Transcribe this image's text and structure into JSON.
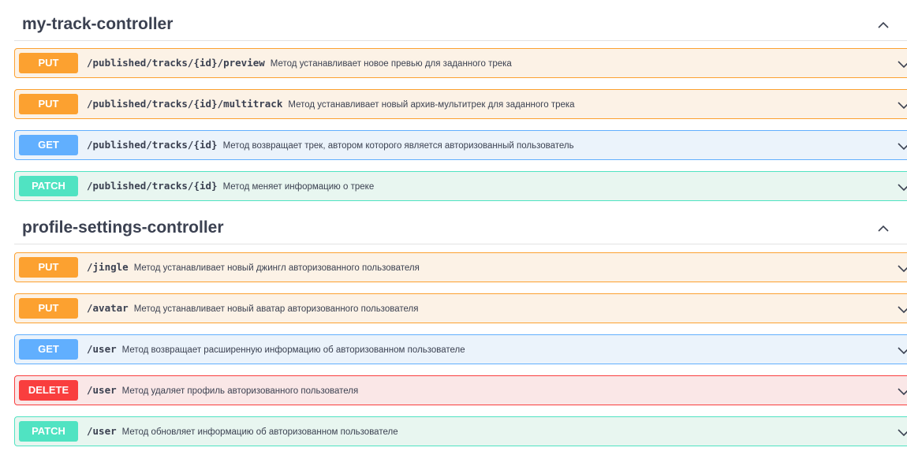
{
  "sections": [
    {
      "title": "my-track-controller",
      "endpoints": [
        {
          "method": "PUT",
          "path": "/published/tracks/{id}/preview",
          "description": "Метод устанавливает новое превью для заданного трека"
        },
        {
          "method": "PUT",
          "path": "/published/tracks/{id}/multitrack",
          "description": "Метод устанавливает новый архив-мультитрек для заданного трека"
        },
        {
          "method": "GET",
          "path": "/published/tracks/{id}",
          "description": "Метод возвращает трек, автором которого является авторизованный пользователь"
        },
        {
          "method": "PATCH",
          "path": "/published/tracks/{id}",
          "description": "Метод меняет информацию о треке"
        }
      ]
    },
    {
      "title": "profile-settings-controller",
      "endpoints": [
        {
          "method": "PUT",
          "path": "/jingle",
          "description": "Метод устанавливает новый джингл авторизованного пользователя"
        },
        {
          "method": "PUT",
          "path": "/avatar",
          "description": "Метод устанавливает новый аватар авторизованного пользователя"
        },
        {
          "method": "GET",
          "path": "/user",
          "description": "Метод возвращает расширенную информацию об авторизованном пользователе"
        },
        {
          "method": "DELETE",
          "path": "/user",
          "description": "Метод удаляет профиль авторизованного пользователя"
        },
        {
          "method": "PATCH",
          "path": "/user",
          "description": "Метод обновляет информацию об авторизованном пользователе"
        }
      ]
    }
  ],
  "icons": {
    "section_toggle": "chevron-up-icon",
    "endpoint_toggle": "chevron-down-icon"
  },
  "colors": {
    "put": "#fca130",
    "get": "#61affe",
    "patch": "#50e3c2",
    "delete": "#f93e3e",
    "text": "#3b4151"
  }
}
